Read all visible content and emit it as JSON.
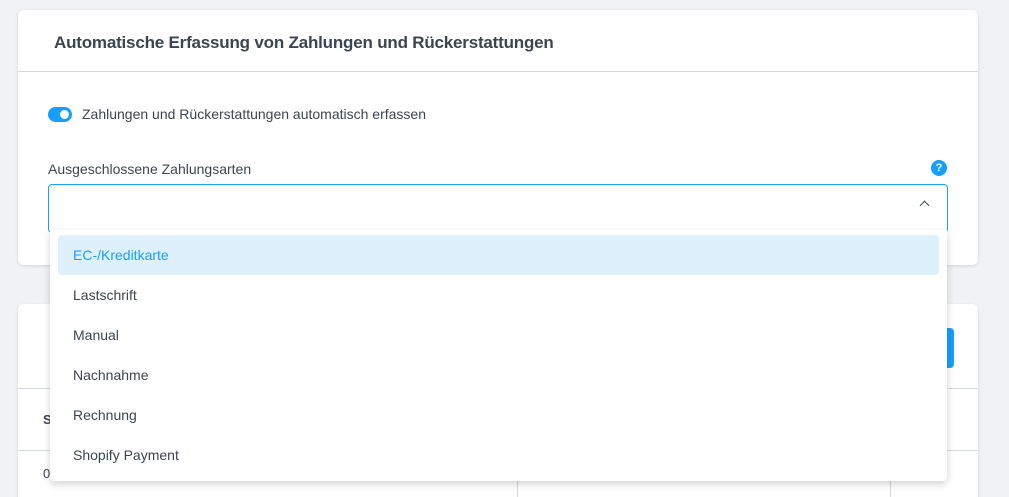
{
  "panel": {
    "title": "Automatische Erfassung von Zahlungen und Rückerstattungen",
    "toggle": {
      "label": "Zahlungen und Rückerstattungen automatisch erfassen",
      "checked": true
    },
    "field": {
      "label": "Ausgeschlossene Zahlungsarten",
      "help": "?"
    }
  },
  "background_stubs": {
    "header_fragment": "S",
    "cell_fragment": "0"
  },
  "dropdown": {
    "options": [
      {
        "label": "EC-/Kreditkarte",
        "highlighted": true
      },
      {
        "label": "Lastschrift",
        "highlighted": false
      },
      {
        "label": "Manual",
        "highlighted": false
      },
      {
        "label": "Nachnahme",
        "highlighted": false
      },
      {
        "label": "Rechnung",
        "highlighted": false
      },
      {
        "label": "Shopify Payment",
        "highlighted": false
      }
    ]
  },
  "colors": {
    "accent": "#189eff",
    "highlight_bg": "#dff0fd",
    "text": "#3b4552",
    "border": "#d1d8e0",
    "page_bg": "#f0f2f5"
  }
}
